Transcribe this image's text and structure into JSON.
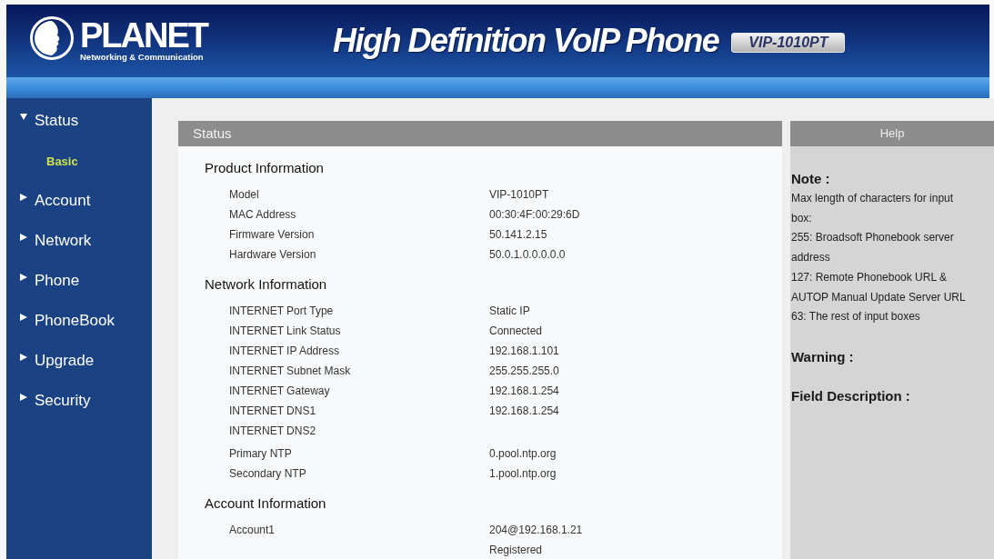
{
  "header": {
    "logo_text": "PLANET",
    "logo_tagline": "Networking & Communication",
    "title": "High Definition VoIP Phone",
    "model_badge": "VIP-1010PT"
  },
  "sidebar": {
    "items": [
      {
        "label": "Status",
        "expanded": true,
        "selected": false,
        "children": [
          {
            "label": "Basic",
            "selected": true
          }
        ]
      },
      {
        "label": "Account",
        "expanded": false,
        "selected": false
      },
      {
        "label": "Network",
        "expanded": false,
        "selected": false
      },
      {
        "label": "Phone",
        "expanded": false,
        "selected": false
      },
      {
        "label": "PhoneBook",
        "expanded": false,
        "selected": false
      },
      {
        "label": "Upgrade",
        "expanded": false,
        "selected": false
      },
      {
        "label": "Security",
        "expanded": false,
        "selected": false
      }
    ]
  },
  "status_panel": {
    "title": "Status",
    "sections": [
      {
        "heading": "Product Information",
        "groups": [
          {
            "rows": [
              {
                "label": "Model",
                "value": "VIP-1010PT"
              },
              {
                "label": "MAC Address",
                "value": "00:30:4F:00:29:6D"
              },
              {
                "label": "Firmware Version",
                "value": "50.141.2.15"
              },
              {
                "label": "Hardware Version",
                "value": "50.0.1.0.0.0.0.0"
              }
            ]
          }
        ]
      },
      {
        "heading": "Network Information",
        "groups": [
          {
            "rows": [
              {
                "label": "INTERNET Port Type",
                "value": "Static IP"
              },
              {
                "label": "INTERNET Link Status",
                "value": "Connected"
              },
              {
                "label": "INTERNET IP Address",
                "value": "192.168.1.101"
              },
              {
                "label": "INTERNET Subnet Mask",
                "value": "255.255.255.0"
              },
              {
                "label": "INTERNET Gateway",
                "value": "192.168.1.254"
              },
              {
                "label": "INTERNET DNS1",
                "value": "192.168.1.254"
              },
              {
                "label": "INTERNET DNS2"
              }
            ]
          },
          {
            "rows": [
              {
                "label": "Primary NTP",
                "value": "0.pool.ntp.org"
              },
              {
                "label": "Secondary NTP",
                "value": "1.pool.ntp.org"
              }
            ]
          }
        ]
      },
      {
        "heading": "Account Information",
        "groups": [
          {
            "rows": [
              {
                "label": "Account1",
                "value": "204@192.168.1.21"
              },
              {
                "value": "Registered"
              }
            ]
          }
        ]
      }
    ]
  },
  "help_panel": {
    "title": "Help",
    "note_heading": "Note :",
    "note_lines": [
      "Max length of characters for input box:",
      "255: Broadsoft Phonebook server address",
      "127: Remote Phonebook URL & AUTOP Manual Update Server URL",
      "63: The rest of input boxes"
    ],
    "warning_heading": "Warning :",
    "field_description_heading": "Field Description :"
  }
}
